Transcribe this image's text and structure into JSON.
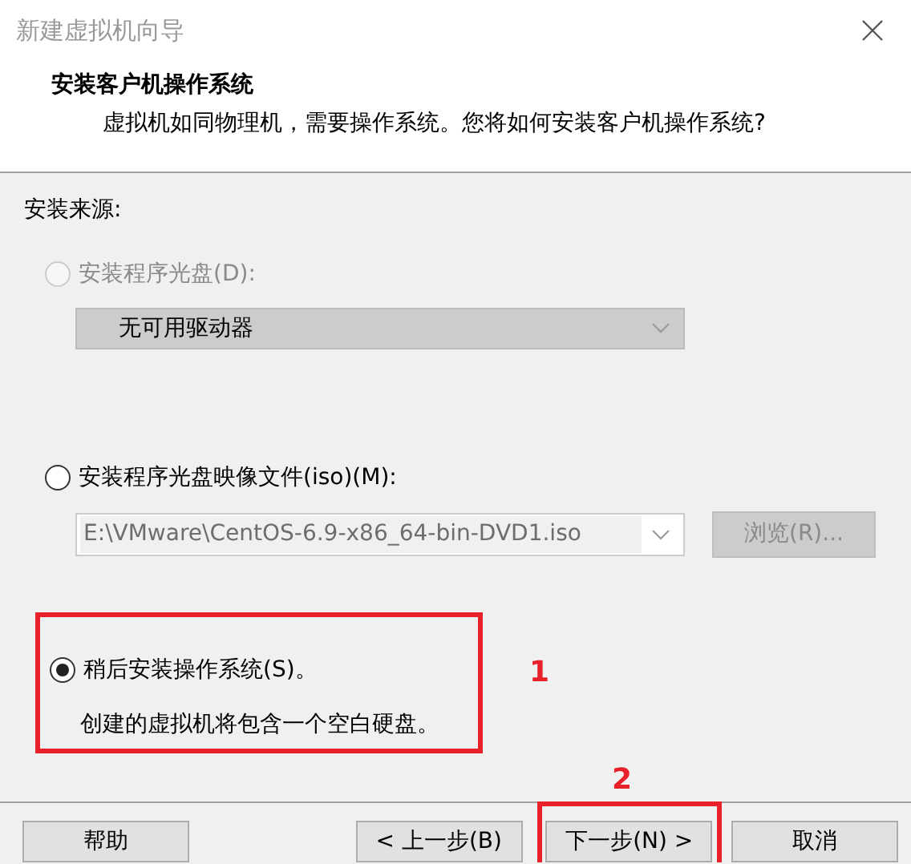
{
  "window": {
    "title": "新建虚拟机向导"
  },
  "header": {
    "title": "安装客户机操作系统",
    "description": "虚拟机如同物理机，需要操作系统。您将如何安装客户机操作系统?"
  },
  "source_label": "安装来源:",
  "options": [
    {
      "kind": "disc",
      "label": "安装程序光盘(D):",
      "selected": false,
      "disabled": true,
      "dropdown": {
        "value": "无可用驱动器",
        "disabled": true
      }
    },
    {
      "kind": "iso",
      "label": "安装程序光盘映像文件(iso)(M):",
      "selected": false,
      "disabled": false,
      "path": {
        "value": "E:\\VMware\\CentOS-6.9-x86_64-bin-DVD1.iso",
        "disabled": true
      },
      "browse_button": {
        "label": "浏览(R)...",
        "disabled": true
      }
    },
    {
      "kind": "later",
      "label": "稍后安装操作系统(S)。",
      "selected": true,
      "disabled": false,
      "description": "创建的虚拟机将包含一个空白硬盘。",
      "annotation": "1"
    }
  ],
  "buttons": [
    {
      "label": "帮助"
    },
    {
      "label": "< 上一步(B)"
    },
    {
      "label": "下一步(N) >",
      "annotation": "2"
    },
    {
      "label": "取消"
    }
  ]
}
